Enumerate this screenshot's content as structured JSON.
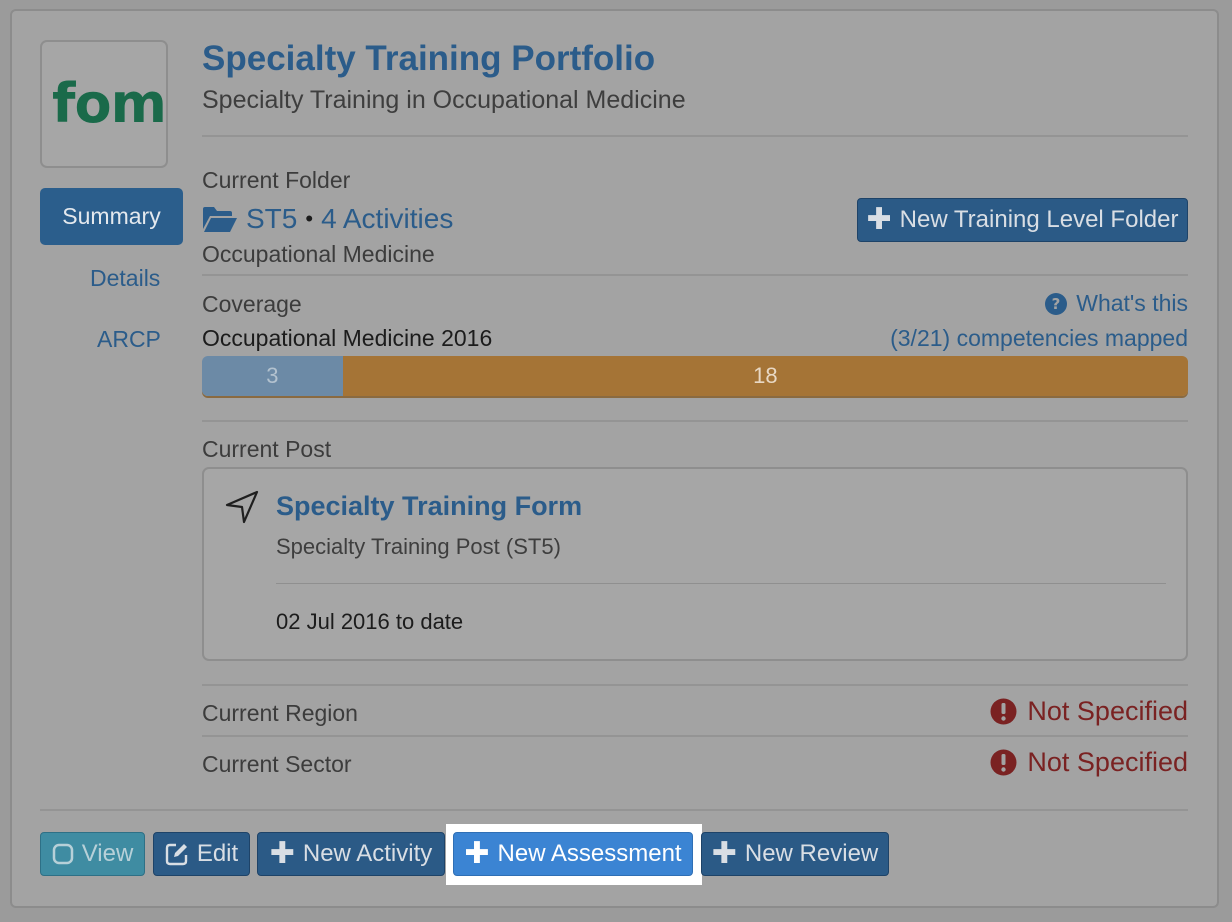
{
  "header": {
    "title": "Specialty Training Portfolio",
    "subtitle": "Specialty Training in Occupational Medicine",
    "logo_text": "fom"
  },
  "nav": {
    "summary": "Summary",
    "details": "Details",
    "arcp": "ARCP"
  },
  "folder": {
    "label": "Current Folder",
    "name": "ST5",
    "separator": "•",
    "activities": "4 Activities",
    "specialty": "Occupational Medicine",
    "new_folder_button": "New Training Level Folder"
  },
  "coverage": {
    "label": "Coverage",
    "whats_this": "What's this",
    "curriculum": "Occupational Medicine 2016",
    "mapped_text": "(3/21) competencies mapped",
    "mapped_value": 3,
    "remaining_value": 18,
    "mapped_label": "3",
    "remaining_label": "18",
    "total": 21,
    "colors": {
      "mapped": "#6c8aa6",
      "remaining": "#a57436"
    }
  },
  "post": {
    "label": "Current Post",
    "form_title": "Specialty Training Form",
    "post_name": "Specialty Training Post (ST5)",
    "dates": "02 Jul 2016 to date"
  },
  "region": {
    "label": "Current Region",
    "value": "Not Specified"
  },
  "sector": {
    "label": "Current Sector",
    "value": "Not Specified"
  },
  "actions": {
    "view": "View",
    "edit": "Edit",
    "new_activity": "New Activity",
    "new_assessment": "New Assessment",
    "new_review": "New Review"
  },
  "icons": {
    "folder": "folder-open-icon",
    "help": "question-circle-icon",
    "location": "location-arrow-icon",
    "warning": "exclamation-circle-icon",
    "plus": "plus-icon",
    "edit": "pencil-square-icon",
    "view": "square-icon"
  }
}
